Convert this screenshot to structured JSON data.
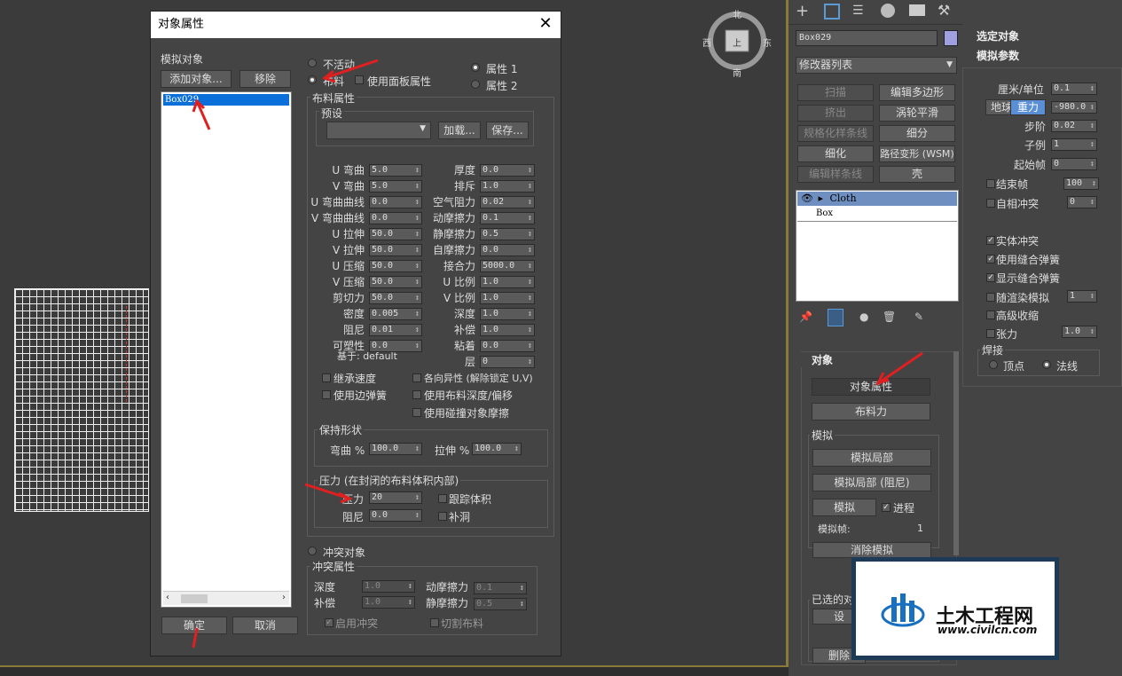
{
  "dialog": {
    "title": "对象属性",
    "close": "✕",
    "sim_objects_label": "模拟对象",
    "add_object": "添加对象...",
    "remove": "移除",
    "list_items": [
      "Box029"
    ],
    "inactive": "不活动",
    "cloth": "布料",
    "use_panel_props": "使用面板属性",
    "prop1": "属性 1",
    "prop2": "属性 2",
    "cloth_props": "布料属性",
    "presets": "预设",
    "load": "加载...",
    "save": "保存...",
    "left_params": [
      {
        "l": "U 弯曲",
        "v": "5.0"
      },
      {
        "l": "V 弯曲",
        "v": "5.0"
      },
      {
        "l": "U 弯曲曲线",
        "v": "0.0"
      },
      {
        "l": "V 弯曲曲线",
        "v": "0.0"
      },
      {
        "l": "U 拉伸",
        "v": "50.0"
      },
      {
        "l": "V 拉伸",
        "v": "50.0"
      },
      {
        "l": "U 压缩",
        "v": "50.0"
      },
      {
        "l": "V 压缩",
        "v": "50.0"
      },
      {
        "l": "剪切力",
        "v": "50.0"
      },
      {
        "l": "密度",
        "v": "0.005"
      },
      {
        "l": "阻尼",
        "v": "0.01"
      },
      {
        "l": "可塑性",
        "v": "0.0"
      }
    ],
    "right_params": [
      {
        "l": "厚度",
        "v": "0.0"
      },
      {
        "l": "排斥",
        "v": "1.0"
      },
      {
        "l": "空气阻力",
        "v": "0.02"
      },
      {
        "l": "动摩擦力",
        "v": "0.1"
      },
      {
        "l": "静摩擦力",
        "v": "0.5"
      },
      {
        "l": "自摩擦力",
        "v": "0.0"
      },
      {
        "l": "接合力",
        "v": "5000.0"
      },
      {
        "l": "U 比例",
        "v": "1.0"
      },
      {
        "l": "V 比例",
        "v": "1.0"
      },
      {
        "l": "深度",
        "v": "1.0"
      },
      {
        "l": "补偿",
        "v": "1.0"
      },
      {
        "l": "粘着",
        "v": "0.0"
      },
      {
        "l": "层",
        "v": "0"
      }
    ],
    "based_on": "基于: default",
    "inherit_velocity": "继承速度",
    "use_edge_springs": "使用边弹簧",
    "anisotropic": "各向异性 (解除锁定 U,V)",
    "use_cloth_depth": "使用布料深度/偏移",
    "use_collision_friction": "使用碰撞对象摩擦",
    "keep_shape": "保持形状",
    "bend_pct": "弯曲 %",
    "bend_pct_val": "100.0",
    "stretch_pct": "拉伸 %",
    "stretch_pct_val": "100.0",
    "pressure_group": "压力 (在封闭的布料体积内部)",
    "pressure": "压力",
    "pressure_val": "20",
    "track_volume": "跟踪体积",
    "damping": "阻尼",
    "damping_val": "0.0",
    "cap_holes": "补洞",
    "collision_object": "冲突对象",
    "collision_props": "冲突属性",
    "c_depth": "深度",
    "c_depth_val": "1.0",
    "c_offset": "补偿",
    "c_offset_val": "1.0",
    "c_dyn_fric": "动摩擦力",
    "c_dyn_fric_val": "0.1",
    "c_stat_fric": "静摩擦力",
    "c_stat_fric_val": "0.5",
    "enable_collisions": "启用冲突",
    "cut_cloth": "切割布料",
    "ok": "确定",
    "cancel": "取消"
  },
  "viewcube": {
    "n": "北",
    "s": "南",
    "w": "西",
    "e": "东",
    "top": "上"
  },
  "panel": {
    "object_name": "Box029",
    "modifier_list": "修改器列表",
    "buttons": [
      [
        "扫描",
        "编辑多边形"
      ],
      [
        "挤出",
        "涡轮平滑"
      ],
      [
        "规格化样条线",
        "细分"
      ],
      [
        "细化",
        "路径变形 (WSM)"
      ],
      [
        "编辑样条线",
        "壳"
      ]
    ],
    "stack": [
      "Cloth",
      "Box"
    ],
    "object_section": "对象",
    "object_props": "对象属性",
    "cloth_forces": "布料力",
    "simulation": "模拟",
    "sim_local": "模拟局部",
    "sim_local_damped": "模拟局部 (阻尼)",
    "simulate": "模拟",
    "progress": "进程",
    "sim_frame_label": "模拟帧:",
    "sim_frame_val": "1",
    "erase_sim": "消除模拟",
    "selected_objects": "已选的对",
    "set": "设",
    "delete_partial": "删除"
  },
  "right2": {
    "selected_object": "选定对象",
    "sim_params": "模拟参数",
    "cm_unit": "厘米/单位",
    "cm_unit_val": "0.1",
    "earth": "地球",
    "gravity": "重力",
    "gravity_val": "-980.0",
    "step": "步阶",
    "step_val": "0.02",
    "subsamples": "子例",
    "subsamples_val": "1",
    "start_frame": "起始帧",
    "start_frame_val": "0",
    "end_frame": "结束帧",
    "end_frame_val": "100",
    "self_collision": "自相冲突",
    "self_collision_val": "0",
    "solid_collision": "实体冲突",
    "use_sewing": "使用缝合弹簧",
    "show_sewing": "显示缝合弹簧",
    "render_sim": "随渲染模拟",
    "render_sim_val": "1",
    "adv_pinch": "高级收缩",
    "tension": "张力",
    "tension_val": "1.0",
    "weld": "焊接",
    "vertex": "顶点",
    "normal": "法线"
  },
  "watermark": {
    "title": "土木工程网",
    "url": "www.civilcn.com"
  }
}
